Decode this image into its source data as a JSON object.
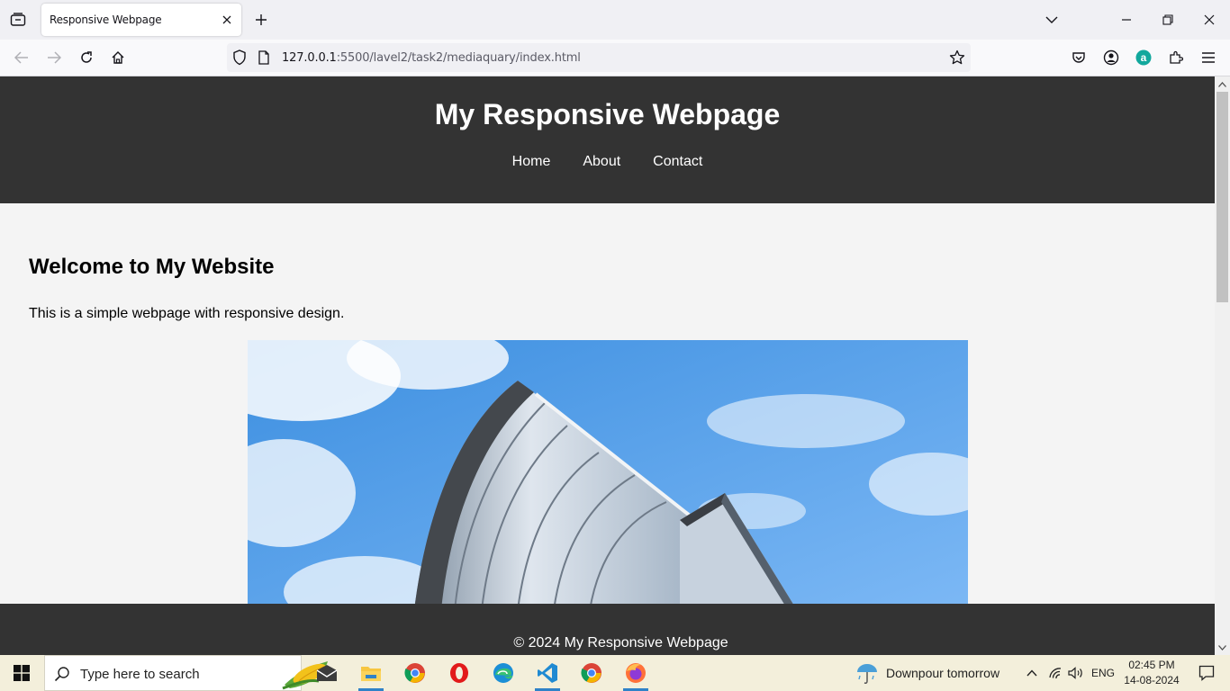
{
  "browser": {
    "tab_title": "Responsive Webpage",
    "url_host": "127.0.0.1",
    "url_rest": ":5500/lavel2/task2/mediaquary/index.html"
  },
  "page": {
    "title": "My Responsive Webpage",
    "nav": [
      "Home",
      "About",
      "Contact"
    ],
    "heading": "Welcome to My Website",
    "intro": "This is a simple webpage with responsive design.",
    "hero_image": "office-building-photo",
    "footer": "© 2024 My Responsive Webpage"
  },
  "taskbar": {
    "search_placeholder": "Type here to search",
    "apps": [
      "mail-icon",
      "file-explorer-icon",
      "chrome-icon",
      "opera-icon",
      "edge-icon",
      "vscode-icon",
      "chrome-icon",
      "firefox-icon"
    ],
    "weather": "Downpour tomorrow",
    "language": "ENG",
    "time": "02:45 PM",
    "date": "14-08-2024"
  },
  "colors": {
    "header_bg": "#333333",
    "page_bg": "#f4f4f4",
    "taskbar_bg": "#f3efdb"
  }
}
